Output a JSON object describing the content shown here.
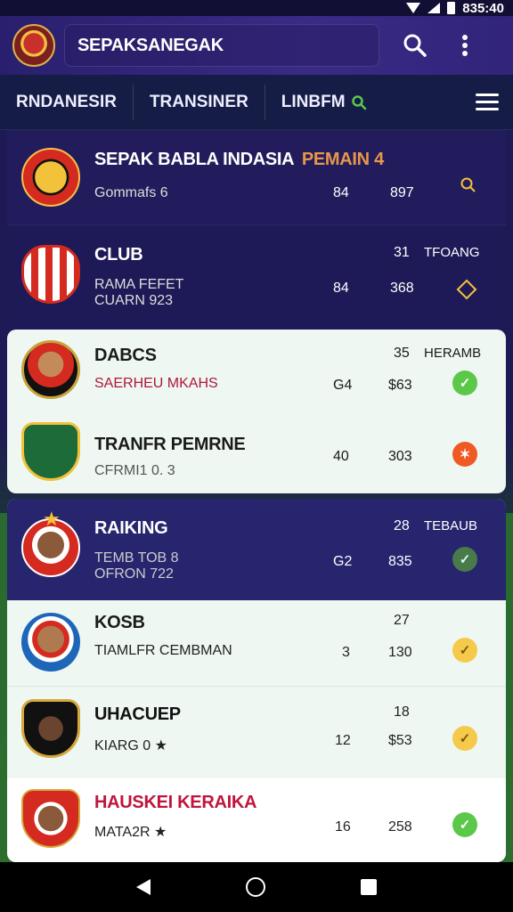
{
  "status": {
    "time": "835:40"
  },
  "app_bar": {
    "title": "SEPAKSANEGAK"
  },
  "tabs": [
    {
      "label": "RNDANESIR"
    },
    {
      "label": "TRANSINER"
    },
    {
      "label": "LINBFM"
    }
  ],
  "colors": {
    "accent_orange": "#e8974a",
    "accent_red": "#c0143c",
    "check_green": "#5cc84a",
    "check_yellow": "#f5c94a",
    "flame_orange": "#ef5a24",
    "card_light": "#eef7f2",
    "header_purple": "#3a2a86"
  },
  "rows": [
    {
      "name": "SEPAK BABLA INDASIA",
      "tag": "PEMAIN 4",
      "sub": "Gommafs 6",
      "v1": "84",
      "v2": "897",
      "icon": "search-icon",
      "badge": "garuda-crest"
    },
    {
      "name": "CLUB",
      "sub1": "RAMA FEFET",
      "sub2": "CUARN 923",
      "top_v": "31",
      "top_label": "TFOANG",
      "v1": "84",
      "v2": "368",
      "icon": "diamond-icon",
      "badge": "red-white-shield"
    },
    {
      "name": "DABCS",
      "sub": "SAERHEU MKAHS",
      "top_v": "35",
      "top_label": "HERAMB",
      "v1": "G4",
      "v2": "$63",
      "icon": "check-icon",
      "badge": "player-crest"
    },
    {
      "name": "TRANFR PEMRNE",
      "sub": "CFRMI1 0. 3",
      "v1": "40",
      "v2": "303",
      "icon": "flame-icon",
      "badge": "green-shield"
    },
    {
      "name": "RAIKING",
      "sub1": "TEMB TOB 8",
      "sub2": "OFRON 722",
      "top_v": "28",
      "top_label": "TEBAUB",
      "v1": "G2",
      "v2": "835",
      "icon": "check-icon",
      "badge": "star-player"
    },
    {
      "name": "KOSB",
      "sub": "TIAMLFR CEMBMAN",
      "top_v": "27",
      "v1": "3",
      "v2": "130",
      "icon": "check-icon",
      "badge": "blue-player"
    },
    {
      "name": "UHACUEP",
      "sub": "KIARG 0 ★",
      "top_v": "18",
      "v1": "12",
      "v2": "$53",
      "icon": "check-icon",
      "badge": "gold-shield-player"
    },
    {
      "name": "HAUSKEI KERAIKA",
      "sub": "MATA2R ★",
      "v1": "16",
      "v2": "258",
      "icon": "check-icon",
      "badge": "red-shield-player"
    }
  ]
}
